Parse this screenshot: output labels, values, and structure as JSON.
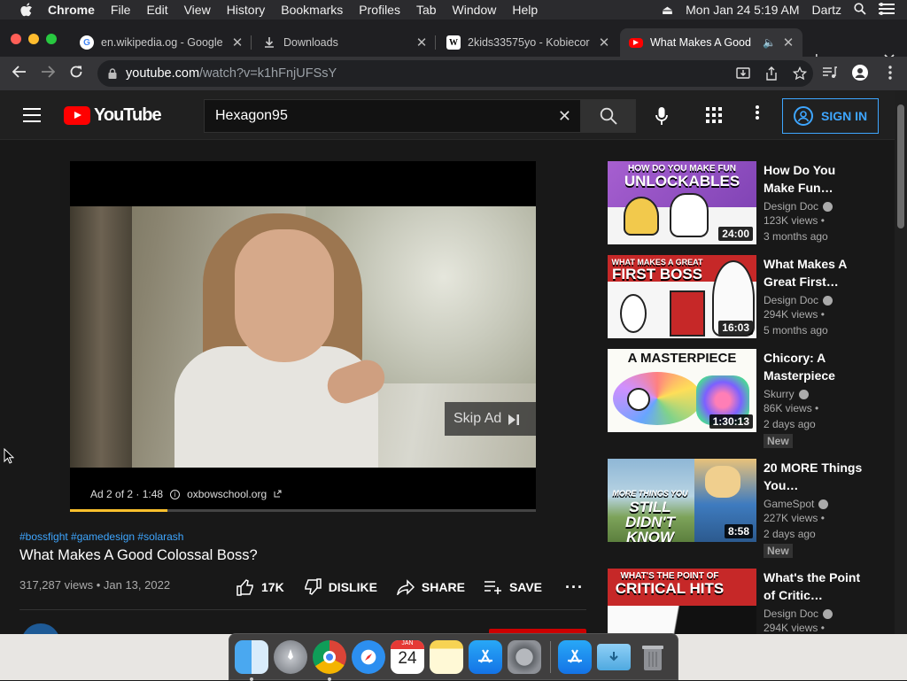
{
  "menubar": {
    "app": "Chrome",
    "items": [
      "File",
      "Edit",
      "View",
      "History",
      "Bookmarks",
      "Profiles",
      "Tab",
      "Window",
      "Help"
    ],
    "datetime": "Mon Jan 24  5:19 AM",
    "user": "Dartz"
  },
  "tabs": [
    {
      "title": "en.wikipedia.og - Google",
      "favicon": "google-icon"
    },
    {
      "title": "Downloads",
      "favicon": "download-icon"
    },
    {
      "title": "2kids33575yo - Kobiecor",
      "favicon": "wikipedia-icon"
    },
    {
      "title": "What Makes A Good",
      "favicon": "youtube-icon",
      "active": true
    }
  ],
  "omnibox": {
    "host": "youtube.com",
    "path": "/watch?v=k1hFnjUFSsY"
  },
  "youtube": {
    "logo_text": "YouTube",
    "search_value": "Hexagon95",
    "signin_label": "SIGN IN"
  },
  "player": {
    "skip_label": "Skip Ad",
    "ad_info": "Ad 2 of 2 · 1:48",
    "ad_domain": "oxbowschool.org",
    "progress": 0.21
  },
  "video": {
    "tags": "#bossfight #gamedesign #solarash",
    "title": "What Makes A Good Colossal Boss?",
    "stats": "317,287 views • Jan 13, 2022",
    "like_count": "17K",
    "dislike_label": "DISLIKE",
    "share_label": "SHARE",
    "save_label": "SAVE"
  },
  "recommendations": [
    {
      "title": "How Do You Make Fun…",
      "channel": "Design Doc",
      "views": "123K views •",
      "age": "3 months ago",
      "duration": "24:00",
      "thumb_title_top": "HOW DO YOU MAKE FUN",
      "thumb_title_main": "UNLOCKABLES",
      "badge": ""
    },
    {
      "title": "What Makes A Great First…",
      "channel": "Design Doc",
      "views": "294K views •",
      "age": "5 months ago",
      "duration": "16:03",
      "thumb_title_top": "WHAT MAKES A GREAT",
      "thumb_title_main": "FIRST BOSS",
      "badge": ""
    },
    {
      "title": "Chicory: A Masterpiece",
      "channel": "Skurry",
      "views": "86K views •",
      "age": "2 days ago",
      "duration": "1:30:13",
      "thumb_title_top": "",
      "thumb_title_main": "A MASTERPIECE",
      "badge": "New"
    },
    {
      "title": "20 MORE Things You…",
      "channel": "GameSpot",
      "views": "227K views •",
      "age": "2 days ago",
      "duration": "8:58",
      "thumb_title_top": "MORE THINGS YOU",
      "thumb_title_main": "STILL DIDN'T KNOW",
      "badge": "New"
    },
    {
      "title": "What's the Point of Critic…",
      "channel": "Design Doc",
      "views": "294K views •",
      "age": "",
      "duration": "",
      "thumb_title_top": "WHAT'S THE POINT OF",
      "thumb_title_main": "CRITICAL HITS",
      "badge": ""
    }
  ],
  "dock": {
    "apps": [
      "finder-icon",
      "launchpad-icon",
      "chrome-icon",
      "safari-icon",
      "calendar-icon",
      "notes-icon",
      "app-store-icon",
      "system-preferences-icon",
      "app-store-folder-icon",
      "downloads-folder-icon",
      "trash-icon"
    ],
    "calendar_month": "JAN",
    "calendar_day": "24"
  },
  "colors": {
    "yt_red": "#ff0000",
    "link_blue": "#3ea6ff",
    "ad_yellow": "#fbc02d"
  }
}
